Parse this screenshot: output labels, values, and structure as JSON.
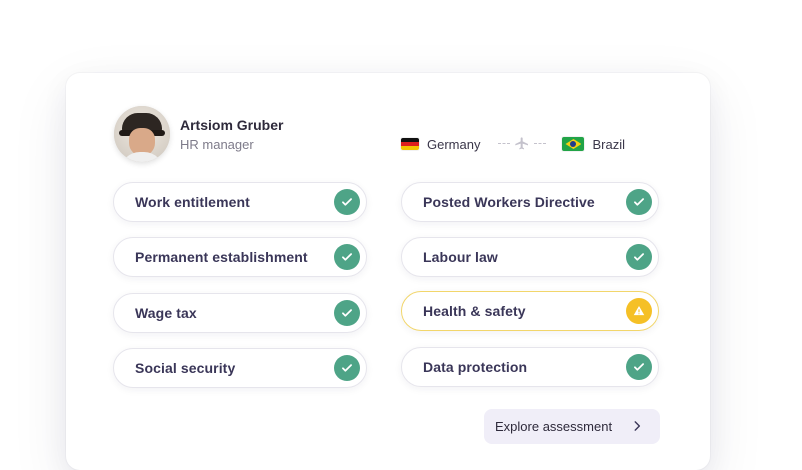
{
  "profile": {
    "name": "Artsiom Gruber",
    "role": "HR manager"
  },
  "route": {
    "from": {
      "country": "Germany",
      "flag_icon": "germany-flag-icon"
    },
    "to": {
      "country": "Brazil",
      "flag_icon": "brazil-flag-icon"
    },
    "connector_icon": "airplane-icon"
  },
  "checks": [
    {
      "label": "Work entitlement",
      "status": "ok",
      "icon": "check-circle-icon"
    },
    {
      "label": "Posted Workers Directive",
      "status": "ok",
      "icon": "check-circle-icon"
    },
    {
      "label": "Permanent establishment",
      "status": "ok",
      "icon": "check-circle-icon"
    },
    {
      "label": "Labour law",
      "status": "ok",
      "icon": "check-circle-icon"
    },
    {
      "label": "Wage tax",
      "status": "ok",
      "icon": "check-circle-icon"
    },
    {
      "label": "Health & safety",
      "status": "warning",
      "icon": "warning-icon"
    },
    {
      "label": "Social security",
      "status": "ok",
      "icon": "check-circle-icon"
    },
    {
      "label": "Data protection",
      "status": "ok",
      "icon": "check-circle-icon"
    }
  ],
  "cta": {
    "label": "Explore assessment",
    "icon": "chevron-right-icon"
  },
  "colors": {
    "ok": "#4ea487",
    "warning": "#f5c026",
    "text": "#3a3658",
    "cta_bg": "#f0eef8"
  }
}
